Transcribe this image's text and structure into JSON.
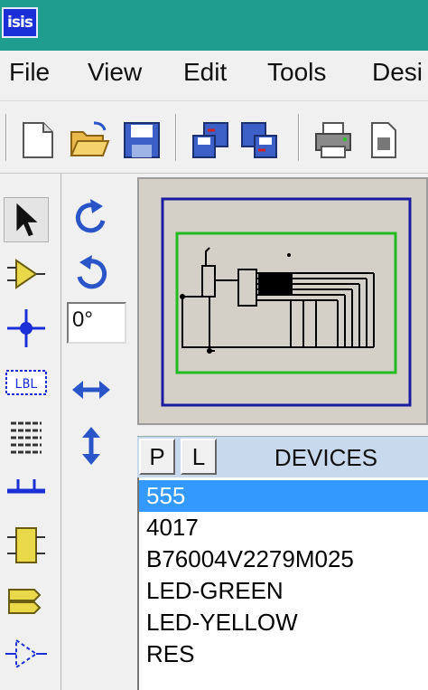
{
  "app": {
    "logo_text": "isis"
  },
  "menu": {
    "items": [
      "File",
      "View",
      "Edit",
      "Tools",
      "Desi"
    ]
  },
  "toolbar": {
    "buttons": [
      "new-file-icon",
      "open-folder-icon",
      "save-icon",
      "import-section-icon",
      "export-section-icon",
      "print-icon",
      "print-setup-icon"
    ]
  },
  "tools": {
    "left": [
      "selection-arrow-icon",
      "component-icon",
      "junction-dot-icon",
      "wire-label-icon",
      "text-script-icon",
      "bus-icon",
      "subcircuit-icon",
      "terminal-icon",
      "device-pin-icon"
    ],
    "middle": [
      "rotate-clockwise-icon",
      "rotate-anticlockwise-icon",
      "flip-horizontal-icon",
      "flip-vertical-icon"
    ],
    "rotation_value": "0°"
  },
  "devices": {
    "p_label": "P",
    "l_label": "L",
    "title": "DEVICES",
    "items": [
      "555",
      "4017",
      "B76004V2279M025",
      "LED-GREEN",
      "LED-YELLOW",
      "RES"
    ],
    "selected_index": 0
  },
  "colors": {
    "titlebar": "#1f9e8f",
    "selection": "#3399ff",
    "header": "#c8d9ee",
    "overview_border_outer": "#1a1aa0",
    "overview_border_inner": "#22bb22"
  }
}
